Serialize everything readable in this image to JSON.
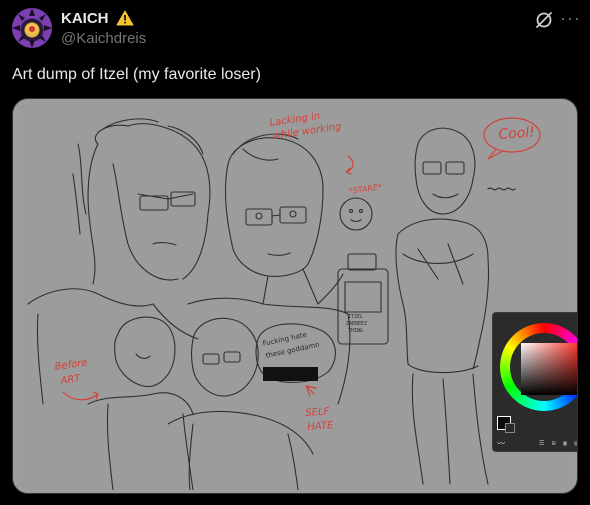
{
  "post": {
    "display_name": "KAICH",
    "handle": "@Kaichdreis",
    "text": "Art dump of Itzel (my favorite loser)"
  },
  "icons": {
    "avatar": "avatar",
    "badge": "warning-icon",
    "grok": "grok-icon",
    "more": "more-icon"
  },
  "colors": {
    "background": "#000000",
    "text": "#e7e9ea",
    "secondary_text": "#71767b",
    "sketch_ink": "#2a2a2a",
    "annotation_red": "#d4413a",
    "warning_yellow": "#f4c430"
  },
  "artwork": {
    "annotations": {
      "lacking_in_will": "Lacking in",
      "lacking_in_will_2": "while working",
      "stare": "*STARE*",
      "cool": "Cool!",
      "before_art": "Before",
      "before_art_2": "ART",
      "self_hate": "SELF",
      "self_hate_2": "HATE",
      "fucking_hate": "Fucking hate",
      "fucking_hate_2": "these goddamn",
      "bottle_1": "ITZEL",
      "bottle_2": "ZAEREEZ",
      "bottle_3": "THING"
    }
  },
  "color_picker": {
    "icons_row": "☰ ⊞ ▣ ▤"
  }
}
